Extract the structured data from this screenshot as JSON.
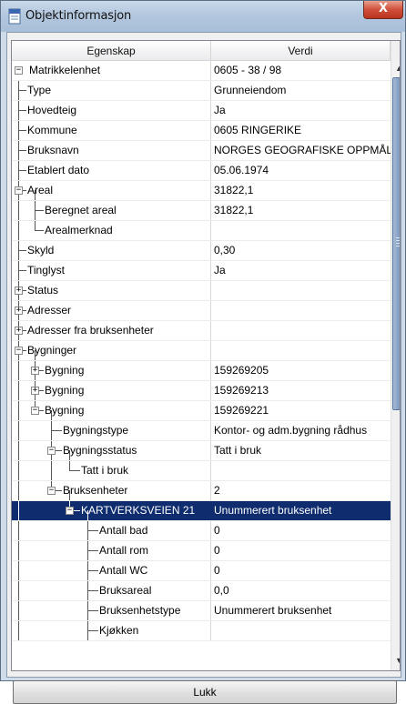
{
  "window": {
    "title": "Objektinformasjon",
    "close_symbol": "X"
  },
  "headers": {
    "property": "Egenskap",
    "value": "Verdi"
  },
  "rows": [
    {
      "label": "Matrikkelenhet",
      "value": "0605 - 38 / 98"
    },
    {
      "label": "Type",
      "value": "Grunneiendom"
    },
    {
      "label": "Hovedteig",
      "value": "Ja"
    },
    {
      "label": "Kommune",
      "value": "0605  RINGERIKE"
    },
    {
      "label": "Bruksnavn",
      "value": "NORGES GEOGRAFISKE OPPMÅLING"
    },
    {
      "label": "Etablert dato",
      "value": "05.06.1974"
    },
    {
      "label": "Areal",
      "value": "31822,1"
    },
    {
      "label": "Beregnet areal",
      "value": "31822,1"
    },
    {
      "label": "Arealmerknad",
      "value": ""
    },
    {
      "label": "Skyld",
      "value": "0,30"
    },
    {
      "label": "Tinglyst",
      "value": "Ja"
    },
    {
      "label": "Status",
      "value": ""
    },
    {
      "label": "Adresser",
      "value": ""
    },
    {
      "label": "Adresser fra bruksenheter",
      "value": ""
    },
    {
      "label": "Bygninger",
      "value": ""
    },
    {
      "label": "Bygning",
      "value": "159269205"
    },
    {
      "label": "Bygning",
      "value": "159269213"
    },
    {
      "label": "Bygning",
      "value": "159269221"
    },
    {
      "label": "Bygningstype",
      "value": "Kontor- og adm.bygning rådhus"
    },
    {
      "label": "Bygningsstatus",
      "value": "Tatt i bruk"
    },
    {
      "label": "Tatt i bruk",
      "value": ""
    },
    {
      "label": "Bruksenheter",
      "value": "2"
    },
    {
      "label": "KARTVERKSVEIEN 21",
      "value": "Unummerert bruksenhet"
    },
    {
      "label": "Antall bad",
      "value": "0"
    },
    {
      "label": "Antall rom",
      "value": "0"
    },
    {
      "label": "Antall WC",
      "value": "0"
    },
    {
      "label": "Bruksareal",
      "value": "0,0"
    },
    {
      "label": "Bruksenhetstype",
      "value": "Unummerert bruksenhet"
    },
    {
      "label": "Kjøkken",
      "value": ""
    }
  ],
  "footer": {
    "close_label": "Lukk"
  },
  "colors": {
    "selection": "#0f2d6e",
    "titlebar": "#b3c7de",
    "close": "#c9432c"
  }
}
